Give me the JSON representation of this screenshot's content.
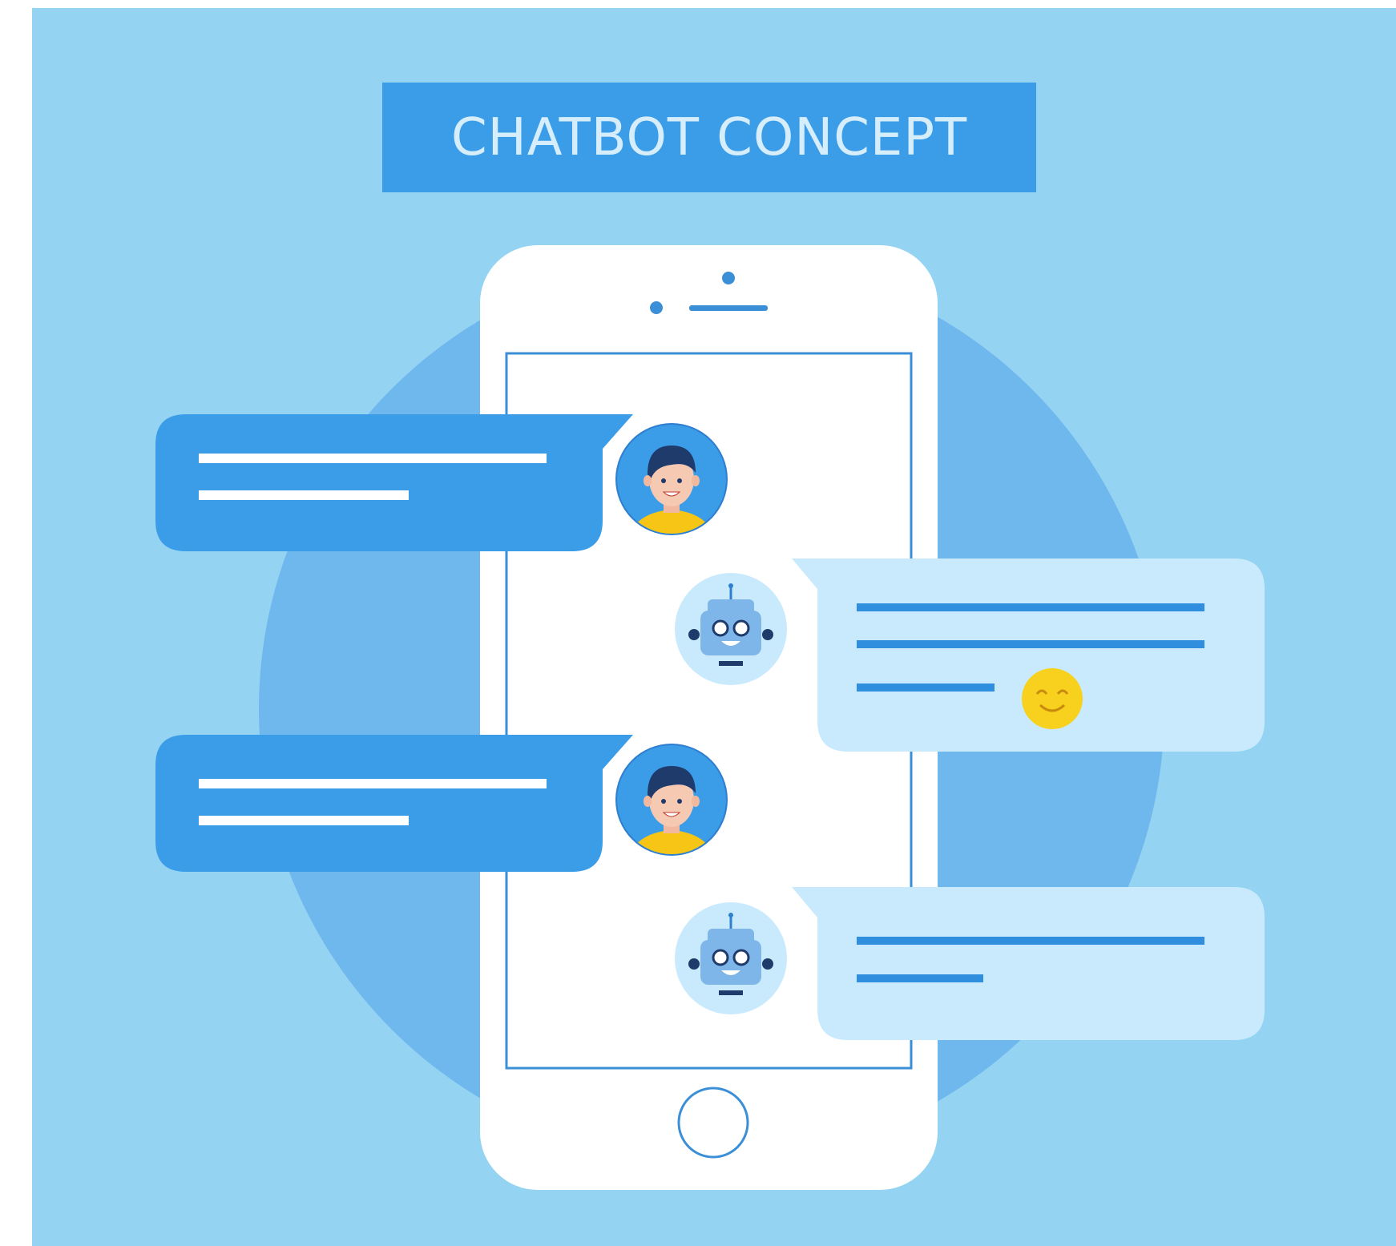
{
  "title": {
    "text": "CHATBOT CONCEPT"
  },
  "colors": {
    "background": "#95D3F2",
    "circle": "#6FB8EE",
    "title_banner": "#3B9DE8",
    "title_text": "#D6EEFC",
    "phone_body": "#FFFFFF",
    "phone_outline": "#3B8FD6",
    "user_bubble": "#3B9DE8",
    "user_bubble_lines": "#FFFFFF",
    "bot_bubble": "#C9EAFC",
    "bot_bubble_lines": "#2F8FDE",
    "emoji": "#F7D11E"
  },
  "conversation": [
    {
      "sender": "user",
      "avatar": "user-avatar-icon",
      "text_lines": 2
    },
    {
      "sender": "bot",
      "avatar": "robot-avatar-icon",
      "text_lines": 3,
      "emoji": "smiling-face-icon"
    },
    {
      "sender": "user",
      "avatar": "user-avatar-icon",
      "text_lines": 2
    },
    {
      "sender": "bot",
      "avatar": "robot-avatar-icon",
      "text_lines": 2
    }
  ]
}
